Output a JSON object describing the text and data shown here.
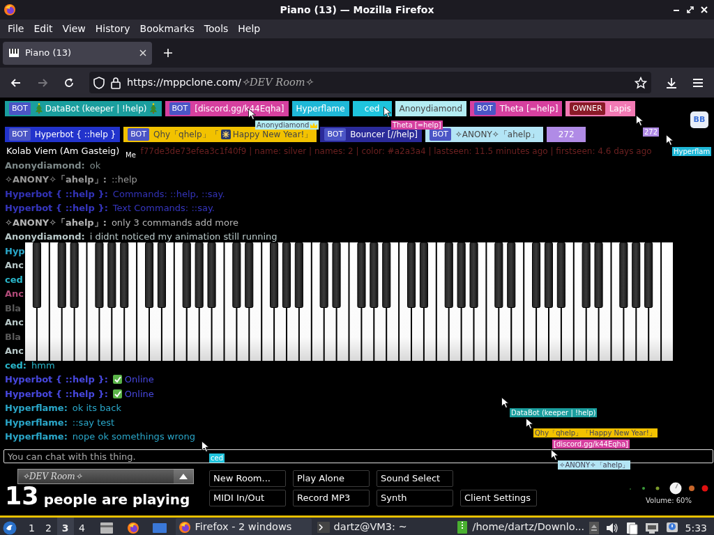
{
  "window": {
    "title": "Piano (13) — Mozilla Firefox"
  },
  "menu": [
    "File",
    "Edit",
    "View",
    "History",
    "Bookmarks",
    "Tools",
    "Help"
  ],
  "tabs": [
    {
      "label": "Piano (13)",
      "selected": true
    }
  ],
  "navigation": {
    "forward_disabled": true
  },
  "address_bar": {
    "url": "https://mppclone.com/",
    "path": "✧DEV Room✧"
  },
  "participants": [
    [
      {
        "tag": "BOT",
        "name": "DataBot (keeper | !help)",
        "color": "#1a9e9e"
      },
      {
        "tag": "BOT",
        "name": "[discord.gg/k44Eqha]",
        "color": "#d6409f"
      },
      {
        "name": "Hyperflame",
        "color": "#1fb8d8"
      },
      {
        "name": "ced",
        "color": "#1fc4dd"
      },
      {
        "name": "Anonydiamond",
        "color": "#b3ecf2"
      },
      {
        "tag": "BOT",
        "name": "Theta [=help]",
        "color": "#d6409f"
      },
      {
        "tag": "OWNER",
        "name": "Lapis",
        "color": "#f27ab4"
      }
    ],
    [
      {
        "tag": "BOT",
        "name": "Hyperbot { ::help }",
        "color": "#2233cc"
      },
      {
        "tag": "BOT",
        "name": "Qhy「qhelp」「",
        "suffix": "Happy New Year!」",
        "color": "#f2c200"
      },
      {
        "tag": "BOT",
        "name": "Bouncer [//help]",
        "color": "#2b2b9a"
      },
      {
        "tag": "BOT",
        "name": "✧ANONY✧「ahelp」",
        "color": "#b3e5f5"
      },
      {
        "name": "272",
        "color": "#b08be6"
      }
    ]
  ],
  "corner_button": "BB",
  "status_text": "Kolab Viem (Am Gasteig)",
  "faded_message": "f77de3de73efea3c1f40f9 | name: silver | names: 2 | color: #a2a3a4 | lastseen: 11.5 minutes ago | firstseen: 4.6 days ago",
  "chat": [
    {
      "name": "Anonydiamond:",
      "text": "ok",
      "color": "#7e8a8a"
    },
    {
      "name": "✧ANONY✧「ahelp」:",
      "text": "::help",
      "color": "#9a9a9a"
    },
    {
      "name": "Hyperbot { ::help }:",
      "text": "Commands: ::help, ::say.",
      "color": "#3333b8"
    },
    {
      "name": "Hyperbot { ::help }:",
      "text": "Text Commands: ::say.",
      "color": "#3636c0"
    },
    {
      "name": "✧ANONY✧「ahelp」:",
      "text": "only 3 commands add more",
      "color": "#b5b5b5"
    },
    {
      "name": "Anonydiamond:",
      "text": "i didnt noticed my animation still running",
      "color": "#b9c9c9"
    },
    {
      "name": "Hyp",
      "color": "#2aa7c9"
    },
    {
      "name": "Anc",
      "color": "#b9c9c9"
    },
    {
      "name": "ced",
      "color": "#2ab8cc"
    },
    {
      "name": "Anc",
      "color": "#b04a78"
    },
    {
      "name": "Bla",
      "color": "#5a5a5a"
    },
    {
      "name": "Anc",
      "color": "#b9c9c9"
    },
    {
      "name": "Bla",
      "color": "#5a5a5a"
    },
    {
      "name": "Anc",
      "color": "#b9c9c9"
    },
    {
      "name": "ced:",
      "text": "hmm",
      "color": "#2ab8cc"
    },
    {
      "name": "Hyperbot { ::help }:",
      "text": "Online",
      "color": "#4848e0"
    },
    {
      "name": "Hyperbot { ::help }:",
      "text": "Online",
      "color": "#4848e0"
    },
    {
      "name": "Hyperflame:",
      "text": "ok its back",
      "color": "#2aa7c9"
    },
    {
      "name": "Hyperflame:",
      "text": "::say test",
      "color": "#2aa7c9"
    },
    {
      "name": "Hyperflame:",
      "text": "nope ok somethings wrong",
      "color": "#2aa7c9"
    }
  ],
  "chat_input": {
    "placeholder": "You can chat with this thing."
  },
  "cursors": [
    {
      "kind": "other",
      "label": "Anonydiamond",
      "color": "#b3ecf2"
    },
    {
      "kind": "other",
      "label": "Theta [=help]",
      "color": "#d6409f"
    },
    {
      "kind": "other",
      "label": "272",
      "color": "#b08be6"
    },
    {
      "kind": "other",
      "label": "Hyperflam",
      "color": "#1fb8d8"
    },
    {
      "kind": "self",
      "label": "Me"
    },
    {
      "kind": "other",
      "label": "ced",
      "color": "#1fc4dd"
    },
    {
      "kind": "other",
      "label": "DataBot (keeper | !help)",
      "color": "#1a9e9e"
    },
    {
      "kind": "other",
      "label": "Qhy「qhelp」「Happy New Year!」",
      "color": "#f2c200"
    },
    {
      "kind": "other",
      "label": "[discord.gg/k44Eqha]",
      "color": "#d6409f"
    },
    {
      "kind": "other",
      "label": "✧ANONY✧「ahelp」",
      "color": "#b3e5f5"
    }
  ],
  "room": {
    "name": "✧DEV Room✧"
  },
  "player_count": {
    "number": "13",
    "label": "people are playing"
  },
  "buttons": [
    [
      "New Room...",
      "Play Alone",
      "Sound Select"
    ],
    [
      "MIDI In/Out",
      "Record MP3",
      "Synth",
      "Client Settings"
    ]
  ],
  "volume": {
    "label": "Volume: 60%"
  },
  "taskbar": {
    "workspaces": [
      {
        "label": "1",
        "selected": false
      },
      {
        "label": "2",
        "selected": false
      },
      {
        "label": "3",
        "selected": true
      },
      {
        "label": "4",
        "selected": false
      }
    ],
    "tasks": [
      {
        "kind": "browser",
        "label": "Firefox - 2 windows",
        "selected": true
      },
      {
        "kind": "terminal",
        "label": "dartz@VM3: ~",
        "selected": false
      },
      {
        "kind": "archive",
        "label": "/home/dartz/Downlo...",
        "selected": false
      }
    ],
    "clock": "5:33"
  }
}
